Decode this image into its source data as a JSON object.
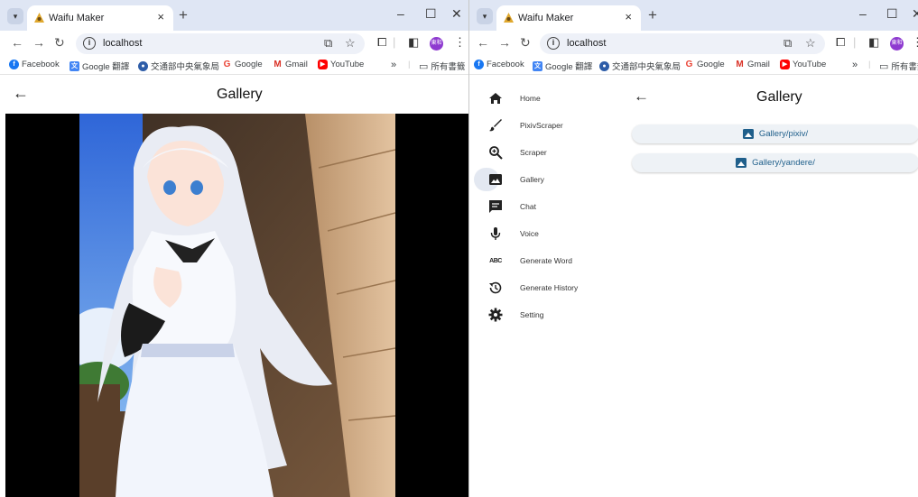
{
  "browser": {
    "tab_title": "Waifu Maker",
    "url": "localhost",
    "profile_initials": "東和",
    "bookmarks": [
      "Facebook",
      "Google 翻譯",
      "交通部中央氣象局",
      "Google",
      "Gmail",
      "YouTube"
    ],
    "bookmarks_overflow": "»",
    "bookmarks_folder": "所有書籤"
  },
  "left_window": {
    "page_title": "Gallery"
  },
  "right_window": {
    "page_title": "Gallery",
    "nav_items": [
      {
        "label": "Home",
        "icon": "home-icon"
      },
      {
        "label": "PixivScraper",
        "icon": "brush-icon"
      },
      {
        "label": "Scraper",
        "icon": "zoom-icon"
      },
      {
        "label": "Gallery",
        "icon": "image-icon",
        "active": true
      },
      {
        "label": "Chat",
        "icon": "chat-icon"
      },
      {
        "label": "Voice",
        "icon": "mic-icon"
      },
      {
        "label": "Generate Word",
        "icon": "abc-icon"
      },
      {
        "label": "Generate History",
        "icon": "history-icon"
      },
      {
        "label": "Setting",
        "icon": "gear-icon"
      }
    ],
    "gallery_folders": [
      "Gallery/pixiv/",
      "Gallery/yandere/"
    ]
  },
  "colors": {
    "accent": "#1f5f8b",
    "tabbar_bg": "#dfe6f4",
    "active_nav_bg": "#e3e8f1"
  }
}
